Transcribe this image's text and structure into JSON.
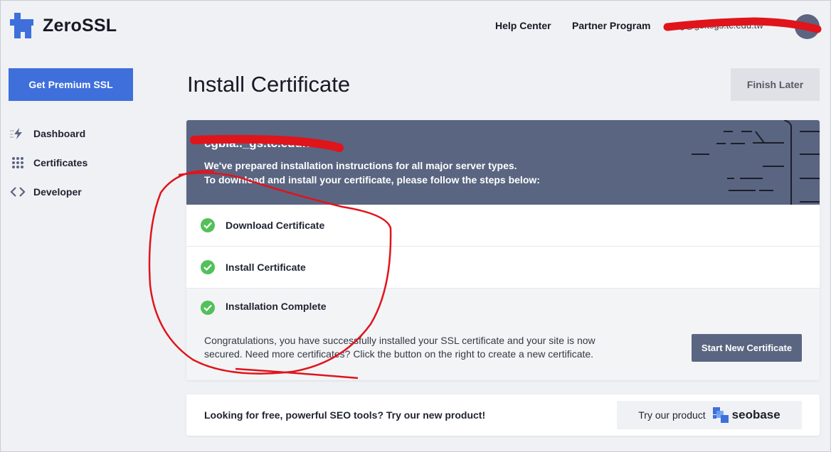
{
  "header": {
    "logo_text": "ZeroSSL",
    "nav": {
      "help": "Help Center",
      "partner": "Partner Program"
    },
    "user_email": "ang@gs.tcgs.tc.edu.tw"
  },
  "sidebar": {
    "premium_button": "Get Premium SSL",
    "items": [
      {
        "label": "Dashboard",
        "icon": "lightning-icon"
      },
      {
        "label": "Certificates",
        "icon": "grid-icon"
      },
      {
        "label": "Developer",
        "icon": "code-icon"
      }
    ]
  },
  "main": {
    "title": "Install Certificate",
    "finish_later": "Finish Later",
    "card": {
      "domain": "cgbia.._gs.tc.edu.tw",
      "intro_line1": "We've prepared installation instructions for all major server types.",
      "intro_line2": "To download and install your certificate, please follow the steps below:",
      "steps": [
        {
          "label": "Download Certificate",
          "status": "complete"
        },
        {
          "label": "Install Certificate",
          "status": "complete"
        },
        {
          "label": "Installation Complete",
          "status": "complete"
        }
      ],
      "congrats_line1": "Congratulations, you have successfully installed your SSL certificate and your site is now",
      "congrats_line2": "secured. Need more certificates? Click the button on the right to create a new certificate.",
      "start_new": "Start New Certificate"
    },
    "promo": {
      "text": "Looking for free, powerful SEO tools? Try our new product!",
      "try_label": "Try our product",
      "brand": "seobase"
    }
  },
  "colors": {
    "accent_blue": "#3e6fdb",
    "card_header": "#5a6581",
    "success_green": "#53c05a",
    "annotation_red": "#e0141b"
  }
}
